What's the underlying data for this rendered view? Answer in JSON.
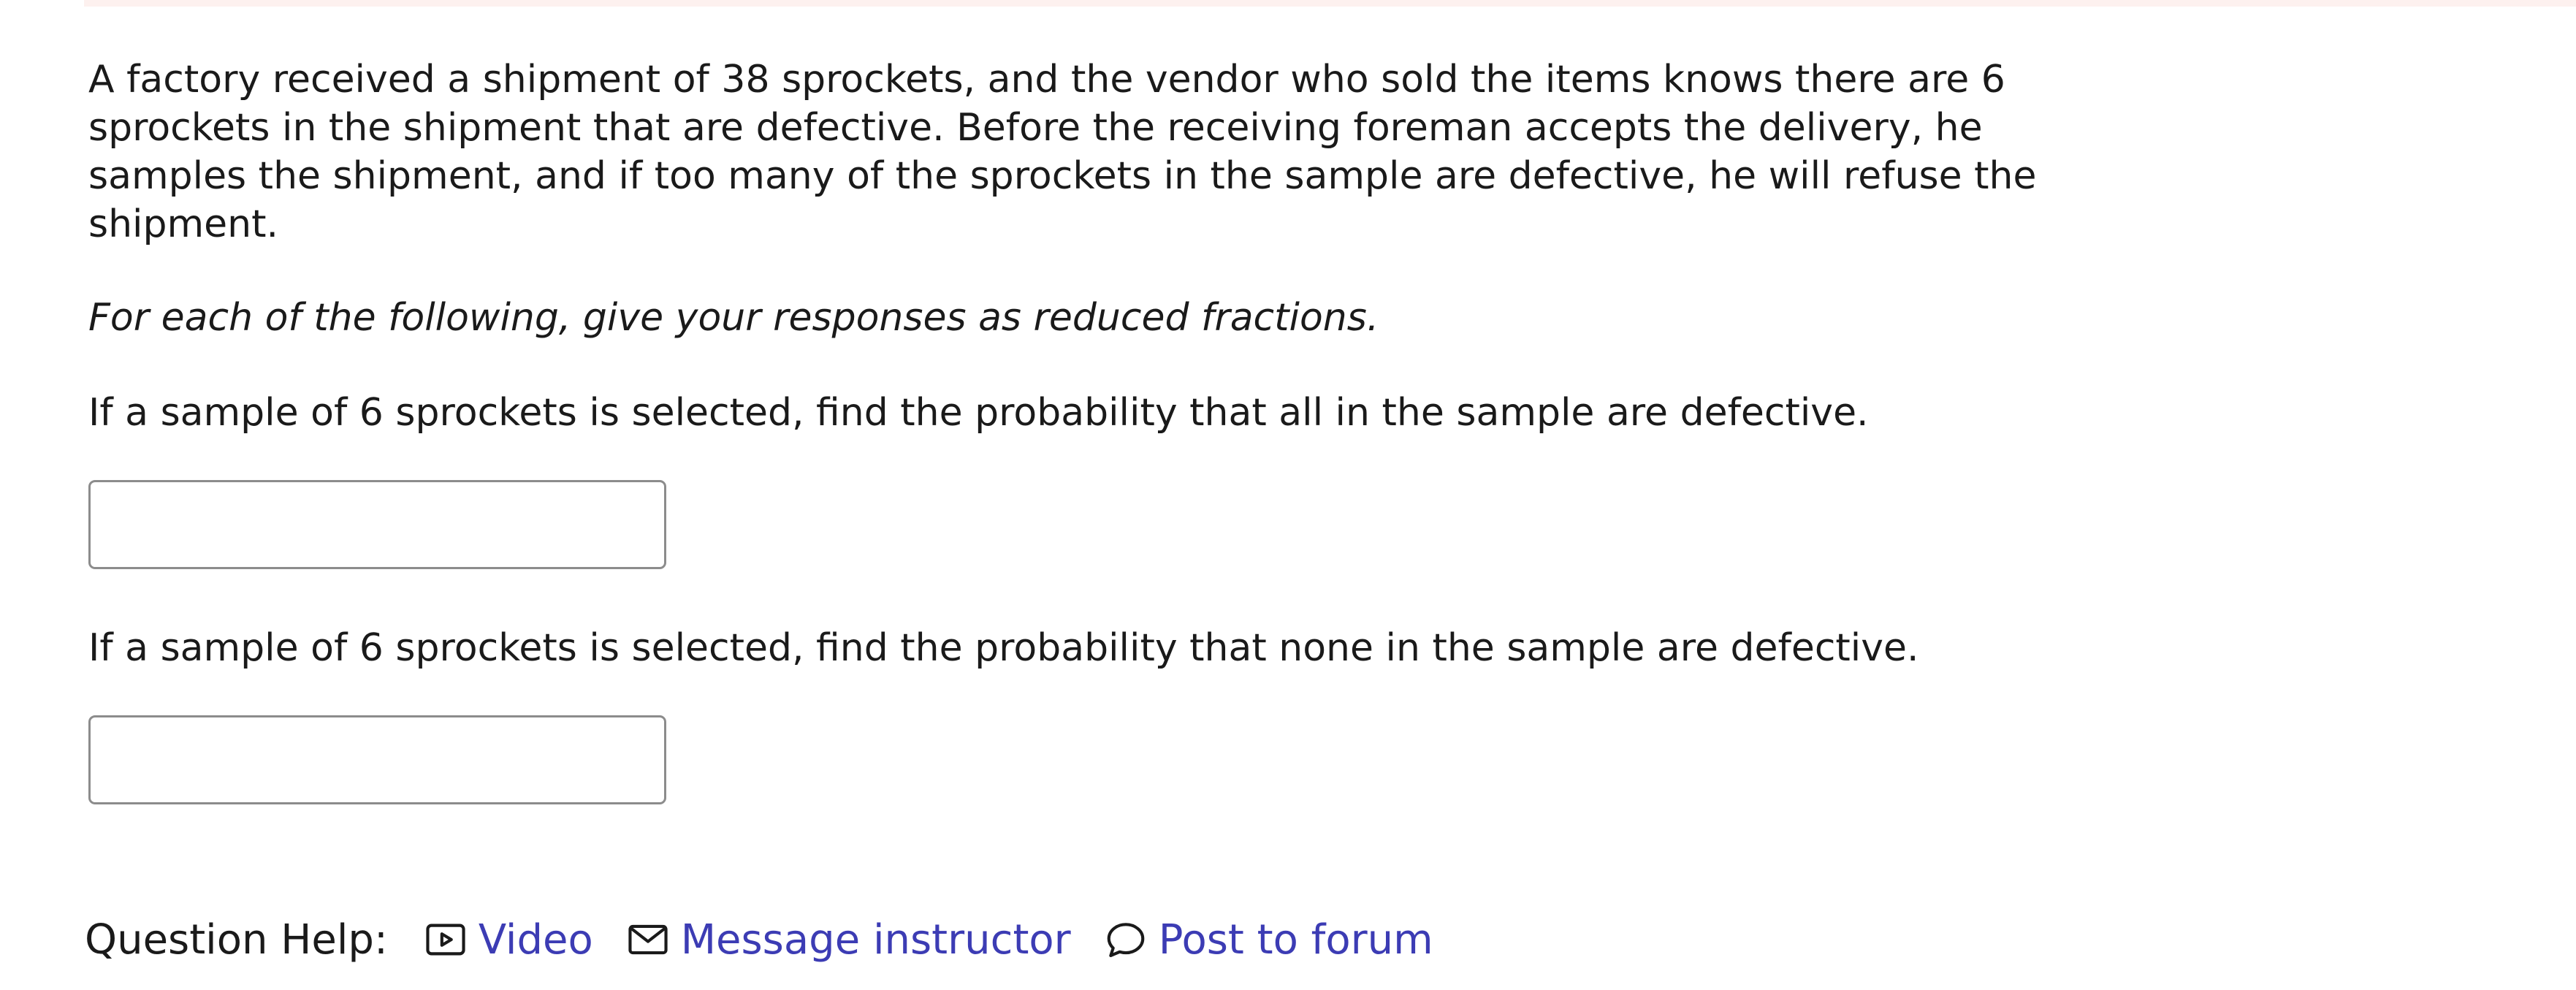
{
  "question": {
    "intro": "A factory received a shipment of 38 sprockets, and the vendor who sold the items knows there are 6 sprockets in the shipment that are defective. Before the receiving foreman accepts the delivery, he samples the shipment, and if too many of the sprockets in the sample are defective, he will refuse the shipment.",
    "instruction": "For each of the following, give your responses as reduced fractions.",
    "parts": [
      {
        "prompt": "If a sample of 6 sprockets is selected, find the probability that all in the sample are defective.",
        "answer_value": ""
      },
      {
        "prompt": "If a sample of 6 sprockets is selected, find the probability that none in the sample are defective.",
        "answer_value": ""
      }
    ]
  },
  "help": {
    "label": "Question Help:",
    "links": [
      {
        "label": "Video",
        "icon": "video-icon"
      },
      {
        "label": "Message instructor",
        "icon": "envelope-icon"
      },
      {
        "label": "Post to forum",
        "icon": "speech-bubble-icon"
      }
    ]
  },
  "colors": {
    "text": "#1a1a1a",
    "link": "#3c3cb4",
    "input_border": "#8c8c8c",
    "top_strip": "#fdf1ef"
  }
}
